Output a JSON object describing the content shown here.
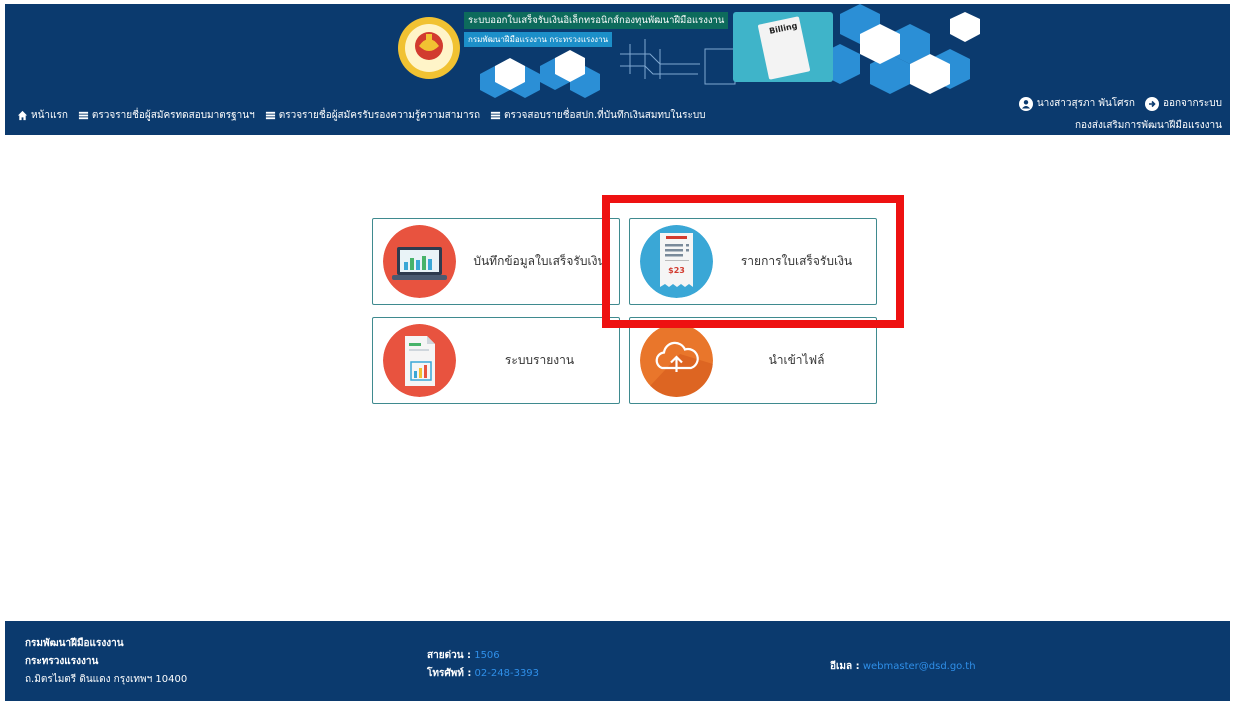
{
  "header": {
    "banner_title": "ระบบออกใบเสร็จรับเงินอิเล็กทรอนิกส์กองทุนพัฒนาฝีมือแรงงาน",
    "banner_subtitle": "กรมพัฒนาฝีมือแรงงาน กระทรวงแรงงาน",
    "billing_text": "Billing",
    "seal_text": "กรมพัฒนาฝีมือแรงงาน"
  },
  "nav": {
    "items": [
      {
        "label": "หน้าแรก",
        "icon": "home-icon"
      },
      {
        "label": "ตรวจรายชื่อผู้สมัครทดสอบมาตรฐานฯ",
        "icon": "list-icon"
      },
      {
        "label": "ตรวจรายชื่อผู้สมัครรับรองความรู้ความสามารถ",
        "icon": "list-icon"
      },
      {
        "label": "ตรวจสอบรายชื่อสปก.ที่บันทึกเงินสมทบในระบบ",
        "icon": "list-icon"
      }
    ]
  },
  "user": {
    "name": "นางสาวสุรภา พันโศรก",
    "logout": "ออกจากระบบ",
    "department": "กองส่งเสริมการพัฒนาฝีมือแรงงาน"
  },
  "tiles": [
    {
      "label": "บันทึกข้อมูลใบเสร็จรับเงิน",
      "icon": "laptop-chart-icon",
      "color": "#e8533f"
    },
    {
      "label": "รายการใบเสร็จรับเงิน",
      "icon": "receipt-icon",
      "color": "#3aa7d6",
      "amount": "$23"
    },
    {
      "label": "ระบบรายงาน",
      "icon": "report-icon",
      "color": "#e8533f"
    },
    {
      "label": "นำเข้าไฟล์",
      "icon": "cloud-upload-icon",
      "color": "#e9762b"
    }
  ],
  "footer": {
    "org1": "กรมพัฒนาฝีมือแรงงาน",
    "org2": "กระทรวงแรงงาน",
    "address": "ถ.มิตรไมตรี ดินแดง กรุงเทพฯ 10400",
    "hotline_label": "สายด่วน :",
    "hotline_value": "1506",
    "phone_label": "โทรศัพท์ :",
    "phone_value": "02-248-3393",
    "email_label": "อีเมล :",
    "email_value": "webmaster@dsd.go.th"
  }
}
